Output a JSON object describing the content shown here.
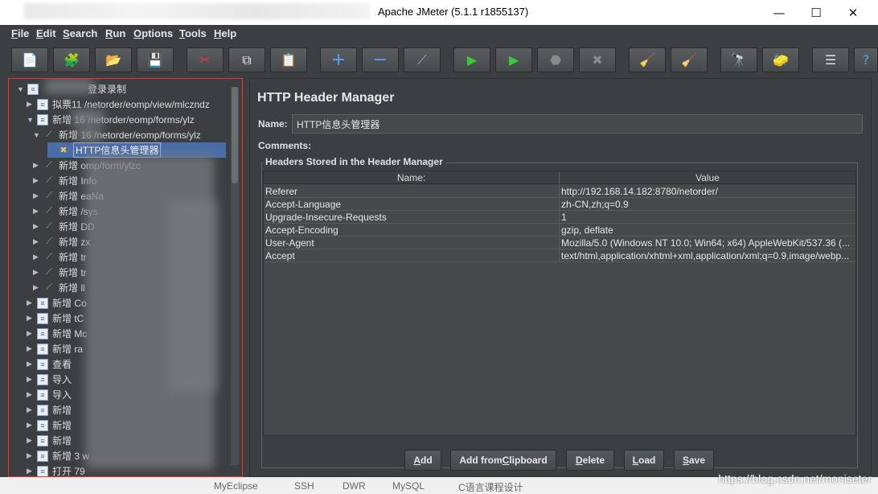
{
  "window": {
    "title": "Apache JMeter (5.1.1 r1855137)",
    "minimize": "—",
    "maximize": "☐",
    "close": "✕"
  },
  "menu": [
    {
      "first": "F",
      "rest": "ile"
    },
    {
      "first": "E",
      "rest": "dit"
    },
    {
      "first": "S",
      "rest": "earch"
    },
    {
      "first": "R",
      "rest": "un"
    },
    {
      "first": "O",
      "rest": "ptions"
    },
    {
      "first": "T",
      "rest": "ools"
    },
    {
      "first": "H",
      "rest": "elp"
    }
  ],
  "toolbar": [
    {
      "icon": "new-icon",
      "glyph": "📄"
    },
    {
      "icon": "templates-icon",
      "glyph": "🧩"
    },
    {
      "icon": "open-icon",
      "glyph": "📂"
    },
    {
      "icon": "save-icon",
      "glyph": "💾"
    },
    {
      "icon": "cut-icon",
      "glyph": "✂"
    },
    {
      "icon": "copy-icon",
      "glyph": "⧉"
    },
    {
      "icon": "paste-icon",
      "glyph": "📋"
    },
    {
      "icon": "expand-icon",
      "glyph": "+"
    },
    {
      "icon": "collapse-icon",
      "glyph": "−"
    },
    {
      "icon": "toggle-icon",
      "glyph": "⟋"
    },
    {
      "icon": "start-icon",
      "glyph": "▶"
    },
    {
      "icon": "start-no-pauses-icon",
      "glyph": "▶"
    },
    {
      "icon": "stop-icon",
      "glyph": "⬣"
    },
    {
      "icon": "shutdown-icon",
      "glyph": "✖"
    },
    {
      "icon": "clear-icon",
      "glyph": "🧹"
    },
    {
      "icon": "clear-all-icon",
      "glyph": "🧹"
    },
    {
      "icon": "search-icon",
      "glyph": "🔭"
    },
    {
      "icon": "reset-search-icon",
      "glyph": "🧽"
    },
    {
      "icon": "function-helper-icon",
      "glyph": "☰"
    },
    {
      "icon": "help-icon",
      "glyph": "?"
    }
  ],
  "tree": {
    "root": "登录录制",
    "nodes": [
      {
        "level": 1,
        "arrow": "▶",
        "icon": "page",
        "label": "拟票11 /netorder/eomp/view/mlczndz"
      },
      {
        "level": 1,
        "arrow": "▼",
        "icon": "page",
        "label": "新增 16 /netorder/eomp/forms/ylz"
      },
      {
        "level": 2,
        "arrow": "▼",
        "icon": "pipe",
        "label": "新增 16 /netorder/eomp/forms/ylz"
      },
      {
        "level": 3,
        "arrow": "",
        "icon": "tool",
        "label": "HTTP信息头管理器",
        "selected": true
      },
      {
        "level": 2,
        "arrow": "▶",
        "icon": "pipe",
        "label": "新增 omp/form/ylzc"
      },
      {
        "level": 2,
        "arrow": "▶",
        "icon": "pipe",
        "label": "新增 Info"
      },
      {
        "level": 2,
        "arrow": "▶",
        "icon": "pipe",
        "label": "新增 eaNa"
      },
      {
        "level": 2,
        "arrow": "▶",
        "icon": "pipe",
        "label": "新增 /sys"
      },
      {
        "level": 2,
        "arrow": "▶",
        "icon": "pipe",
        "label": "新增 DD"
      },
      {
        "level": 2,
        "arrow": "▶",
        "icon": "pipe",
        "label": "新增 zx"
      },
      {
        "level": 2,
        "arrow": "▶",
        "icon": "pipe",
        "label": "新增 tr"
      },
      {
        "level": 2,
        "arrow": "▶",
        "icon": "pipe",
        "label": "新增 tr"
      },
      {
        "level": 2,
        "arrow": "▶",
        "icon": "pipe",
        "label": "新增 ll"
      },
      {
        "level": 1,
        "arrow": "▶",
        "icon": "page",
        "label": "新增 Co"
      },
      {
        "level": 1,
        "arrow": "▶",
        "icon": "page",
        "label": "新增 tC"
      },
      {
        "level": 1,
        "arrow": "▶",
        "icon": "page",
        "label": "新增 Mc"
      },
      {
        "level": 1,
        "arrow": "▶",
        "icon": "page",
        "label": "新增 ra"
      },
      {
        "level": 1,
        "arrow": "▶",
        "icon": "page",
        "label": "查看"
      },
      {
        "level": 1,
        "arrow": "▶",
        "icon": "page",
        "label": "导入"
      },
      {
        "level": 1,
        "arrow": "▶",
        "icon": "page",
        "label": "导入"
      },
      {
        "level": 1,
        "arrow": "▶",
        "icon": "page",
        "label": "新增"
      },
      {
        "level": 1,
        "arrow": "▶",
        "icon": "page",
        "label": "新增"
      },
      {
        "level": 1,
        "arrow": "▶",
        "icon": "page",
        "label": "新增"
      },
      {
        "level": 1,
        "arrow": "▶",
        "icon": "page",
        "label": "新增 3 w"
      },
      {
        "level": 1,
        "arrow": "▶",
        "icon": "page",
        "label": "打开 79"
      }
    ]
  },
  "panel": {
    "title": "HTTP Header Manager",
    "name_label": "Name:",
    "name_value": "HTTP信息头管理器",
    "comments_label": "Comments:",
    "group_title": "Headers Stored in the Header Manager",
    "columns": [
      "Name:",
      "Value"
    ],
    "rows": [
      {
        "name": "Referer",
        "value": "http://192.168.14.182:8780/netorder/"
      },
      {
        "name": "Accept-Language",
        "value": "zh-CN,zh;q=0.9"
      },
      {
        "name": "Upgrade-Insecure-Requests",
        "value": "1"
      },
      {
        "name": "Accept-Encoding",
        "value": "gzip, deflate"
      },
      {
        "name": "User-Agent",
        "value": "Mozilla/5.0 (Windows NT 10.0; Win64; x64) AppleWebKit/537.36 (..."
      },
      {
        "name": "Accept",
        "value": "text/html,application/xhtml+xml,application/xml;q=0.9,image/webp..."
      }
    ],
    "buttons": [
      {
        "first": "",
        "u": "A",
        "rest": "dd"
      },
      {
        "first": "Add from ",
        "u": "C",
        "rest": "lipboard"
      },
      {
        "first": "",
        "u": "D",
        "rest": "elete"
      },
      {
        "first": "",
        "u": "L",
        "rest": "oad"
      },
      {
        "first": "",
        "u": "S",
        "rest": "ave"
      }
    ]
  },
  "bottom": [
    "MyEclipse",
    "SSH",
    "DWR",
    "MySQL",
    "C语言课程设计"
  ],
  "watermark": "https://blog.csdn.net/moniseter"
}
